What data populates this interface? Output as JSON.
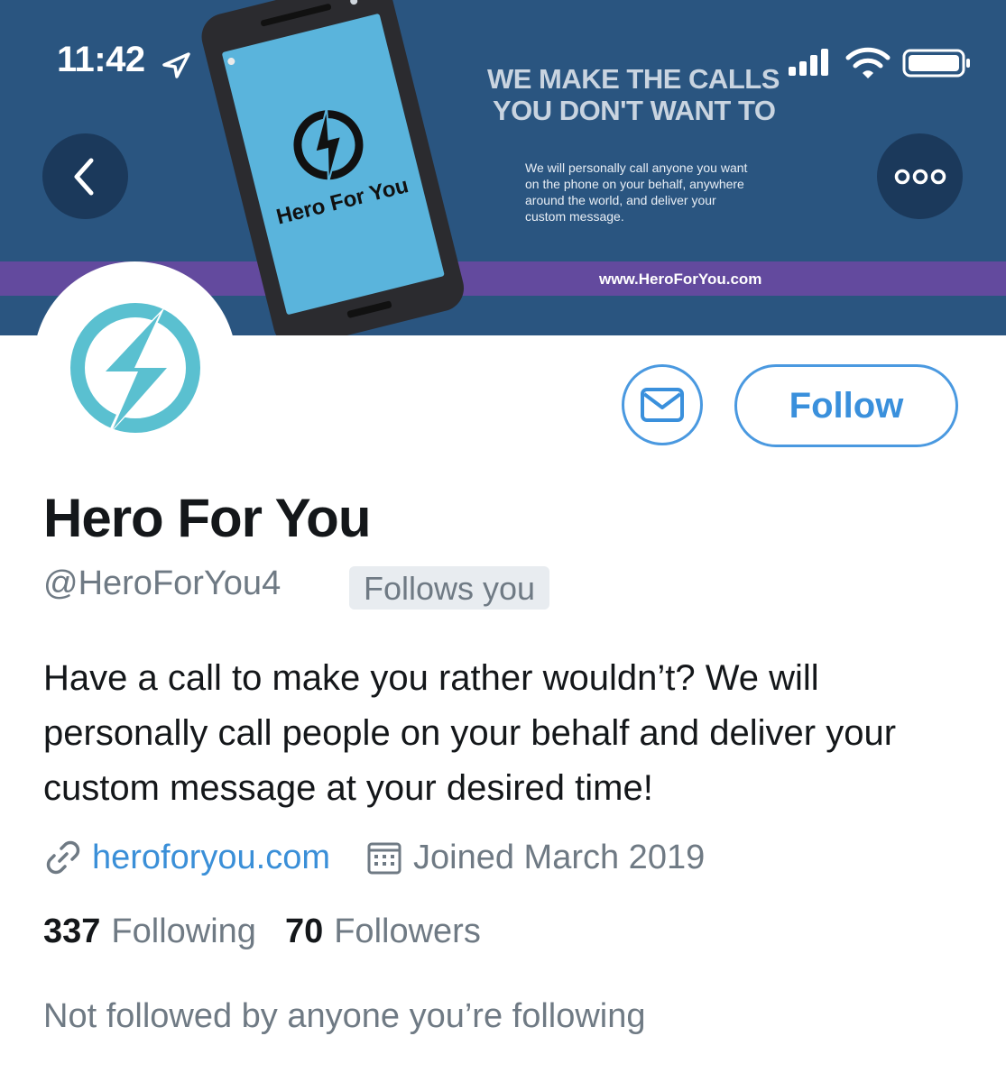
{
  "status_bar": {
    "time": "11:42"
  },
  "banner": {
    "headline_line1": "WE MAKE THE CALLS",
    "headline_line2": "YOU DON'T WANT TO",
    "body": "We will personally call anyone you want on the phone on your behalf, anywhere around the world, and deliver your custom message.",
    "phone_label": "Hero For You",
    "url": "www.HeroForYou.com",
    "colors": {
      "background": "#2a5580",
      "stripe": "#634a9e",
      "phone_screen": "#5ab4dc"
    }
  },
  "nav": {
    "back_icon": "chevron-left-icon",
    "more_icon": "more-dots-icon"
  },
  "profile": {
    "display_name": "Hero For You",
    "handle": "@HeroForYou4",
    "follows_you_badge": "Follows you",
    "bio": "Have a call to make you rather wouldn’t? We will personally call people on your behalf and deliver your custom message at your desired time!",
    "website": "heroforyou.com",
    "joined": "Joined March 2019",
    "following_count": "337",
    "following_label": "Following",
    "followers_count": "70",
    "followers_label": "Followers",
    "known_followers": "Not followed by anyone you’re following"
  },
  "actions": {
    "follow_label": "Follow",
    "message_icon": "mail-icon"
  },
  "colors": {
    "accent": "#3a90dc",
    "secondary_text": "#6f7a84",
    "logo": "#5ac0d0"
  }
}
